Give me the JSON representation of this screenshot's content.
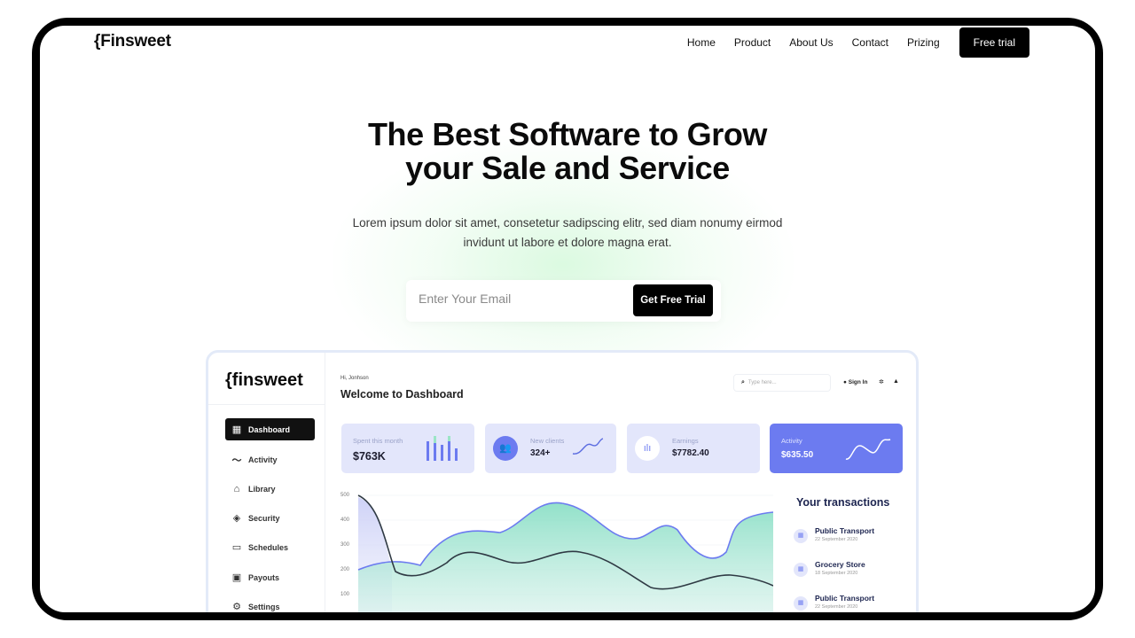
{
  "nav": {
    "logo": "{Finsweet",
    "links": [
      "Home",
      "Product",
      "About Us",
      "Contact",
      "Prizing"
    ],
    "cta": "Free trial"
  },
  "hero": {
    "title_line1": "The Best Software to Grow",
    "title_line2": "your Sale and Service",
    "subtitle_line1": "Lorem ipsum dolor sit amet, consetetur sadipscing elitr, sed diam nonumy eirmod",
    "subtitle_line2": "invidunt ut labore et dolore magna erat.",
    "email_placeholder": "Enter Your Email",
    "cta": "Get Free Trial"
  },
  "dashboard": {
    "logo": "{finsweet",
    "greeting": "Hi, Jonhson",
    "welcome": "Welcome to Dashboard",
    "search_placeholder": "Type here...",
    "sign_in": "Sign In",
    "sidebar": [
      {
        "label": "Dashboard",
        "icon": "grid-icon"
      },
      {
        "label": "Activity",
        "icon": "activity-icon"
      },
      {
        "label": "Library",
        "icon": "library-icon"
      },
      {
        "label": "Security",
        "icon": "shield-icon"
      },
      {
        "label": "Schedules",
        "icon": "calendar-icon"
      },
      {
        "label": "Payouts",
        "icon": "payout-icon"
      },
      {
        "label": "Settings",
        "icon": "gear-icon"
      }
    ],
    "cards": {
      "spent_label": "Spent this month",
      "spent_value": "$763K",
      "clients_label": "New clients",
      "clients_value": "324+",
      "earnings_label": "Earnings",
      "earnings_value": "$7782.40",
      "activity_label": "Activity",
      "activity_value": "$635.50"
    },
    "y_axis": [
      "500",
      "400",
      "300",
      "200",
      "100"
    ],
    "transactions_title": "Your transactions",
    "transactions": [
      {
        "name": "Public Transport",
        "date": "22 September 2020"
      },
      {
        "name": "Grocery Store",
        "date": "18 September 2020"
      },
      {
        "name": "Public Transport",
        "date": "22 September 2020"
      }
    ]
  },
  "colors": {
    "accent": "#6c7bf0",
    "card_bg": "#e3e6fb",
    "cta_bg": "#000000"
  }
}
